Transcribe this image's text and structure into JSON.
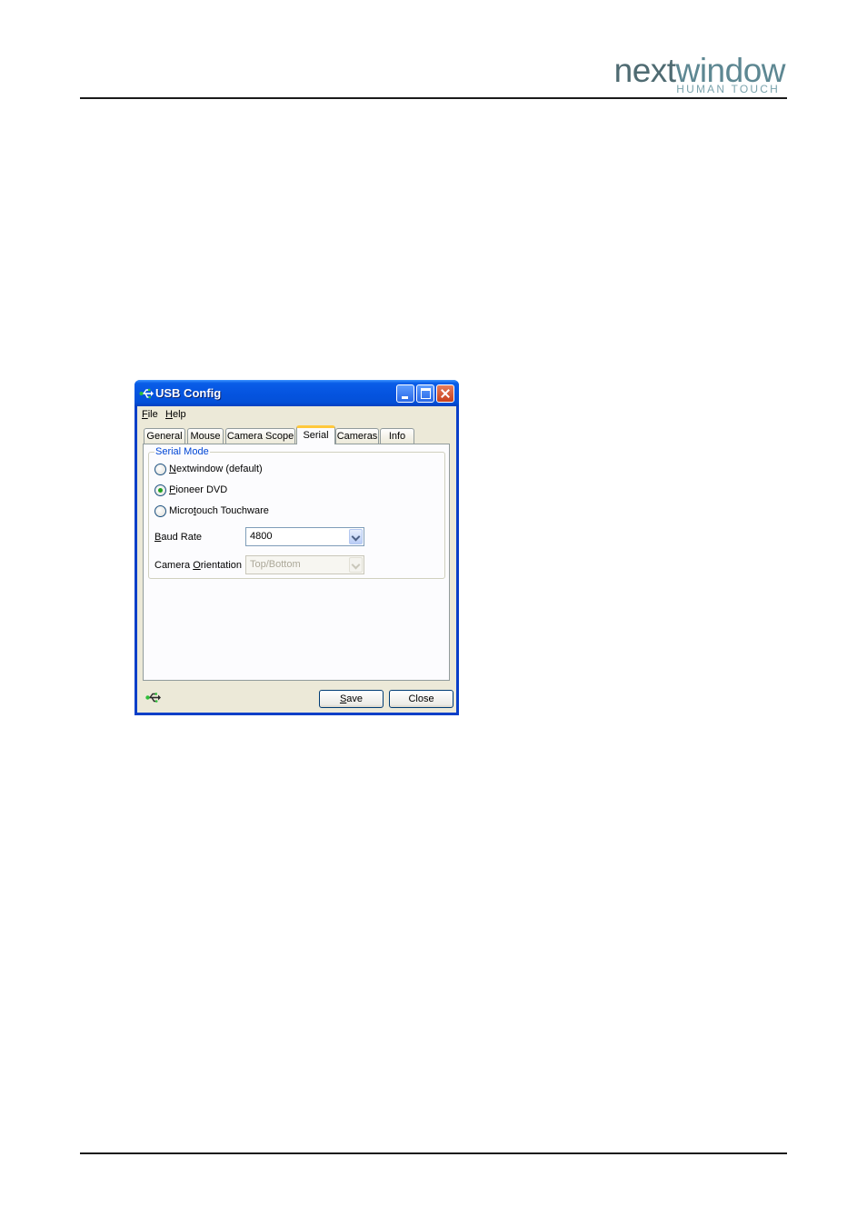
{
  "brand": {
    "name_part1": "next",
    "name_part2": "window",
    "tagline": "HUMAN TOUCH"
  },
  "window": {
    "title": "USB Config"
  },
  "menu": [
    {
      "key": "F",
      "rest": "ile"
    },
    {
      "key": "H",
      "rest": "elp"
    }
  ],
  "tabs": [
    "General",
    "Mouse",
    "Camera Scope",
    "Serial",
    "Cameras",
    "Info"
  ],
  "active_tab": "Serial",
  "serial_mode": {
    "legend": "Serial Mode",
    "options": [
      {
        "key": "N",
        "rest": "extwindow (default)",
        "checked": false
      },
      {
        "key": "P",
        "rest": "ioneer DVD",
        "checked": true
      },
      {
        "pre": "Micro",
        "key": "t",
        "rest": "ouch Touchware",
        "checked": false
      }
    ]
  },
  "baud_rate": {
    "key": "B",
    "rest": "aud Rate",
    "value": "4800"
  },
  "camera_orientation": {
    "pre": "Camera ",
    "key": "O",
    "rest": "rientation",
    "value": "Top/Bottom",
    "disabled": true
  },
  "buttons": {
    "save": {
      "key": "S",
      "rest": "ave"
    },
    "close": "Close"
  },
  "colors": {
    "titlebar": "#0554e0",
    "dialog_bg": "#ece9d8",
    "selected_radio": "#21a121",
    "group_legend": "#0046d5"
  }
}
